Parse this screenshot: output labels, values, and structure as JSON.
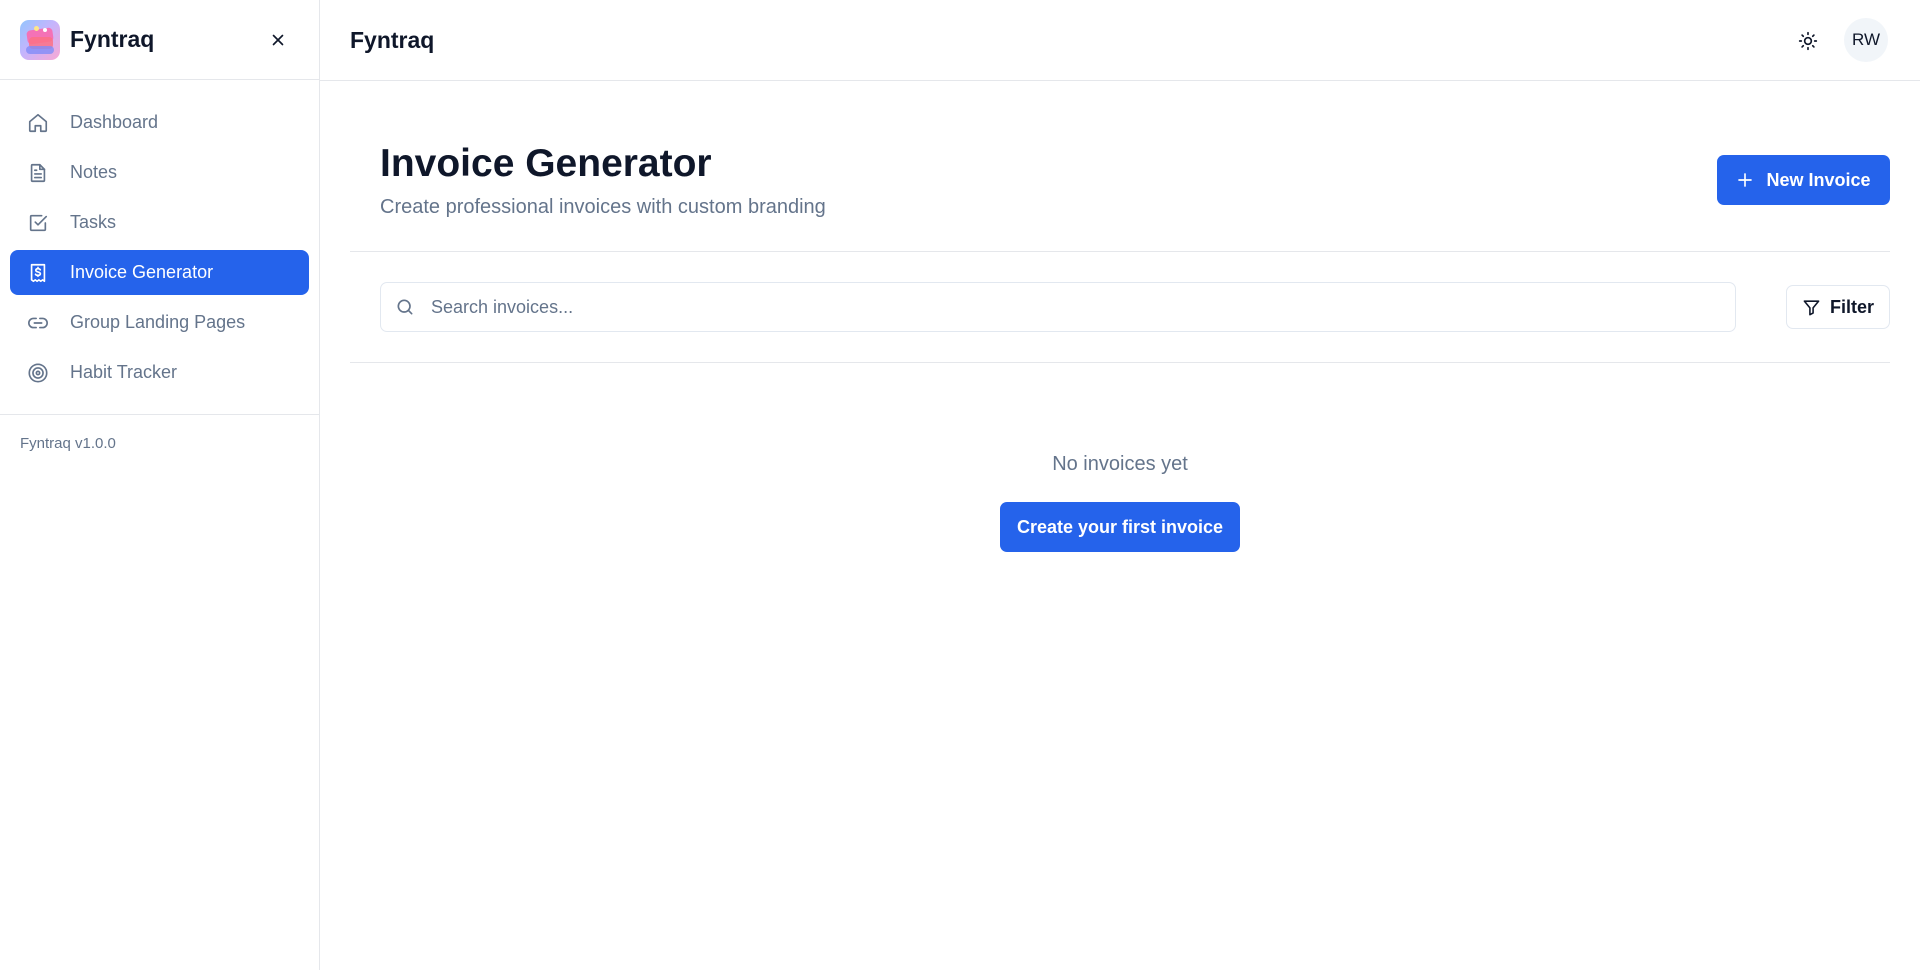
{
  "app": {
    "brand": "Fyntraq",
    "version": "Fyntraq v1.0.0"
  },
  "colors": {
    "accent": "#2563eb",
    "muted_text": "#64748b",
    "border": "#e5e7eb"
  },
  "sidebar": {
    "items": [
      {
        "label": "Dashboard",
        "icon": "home-icon",
        "active": false
      },
      {
        "label": "Notes",
        "icon": "file-text-icon",
        "active": false
      },
      {
        "label": "Tasks",
        "icon": "check-square-icon",
        "active": false
      },
      {
        "label": "Invoice Generator",
        "icon": "dollar-receipt-icon",
        "active": true
      },
      {
        "label": "Group Landing Pages",
        "icon": "link-icon",
        "active": false
      },
      {
        "label": "Habit Tracker",
        "icon": "target-icon",
        "active": false
      }
    ]
  },
  "topbar": {
    "title": "Fyntraq",
    "avatar_initials": "RW"
  },
  "page": {
    "title": "Invoice Generator",
    "subtitle": "Create professional invoices with custom branding",
    "new_button": "New Invoice"
  },
  "search": {
    "placeholder": "Search invoices...",
    "value": ""
  },
  "filter": {
    "label": "Filter"
  },
  "empty_state": {
    "message": "No invoices yet",
    "cta": "Create your first invoice"
  }
}
